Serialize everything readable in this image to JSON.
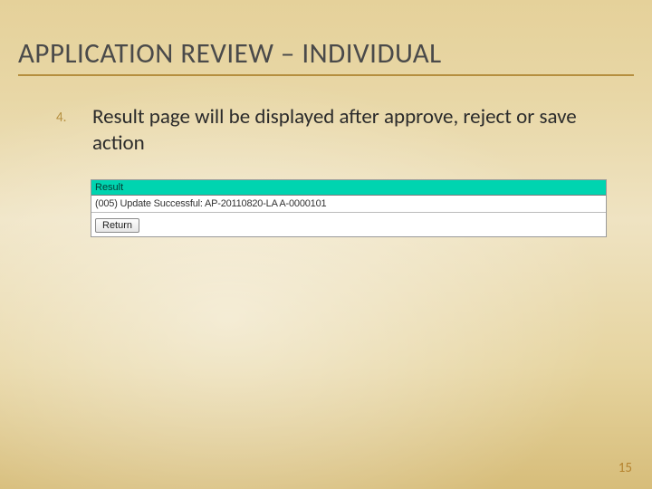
{
  "title": "APPLICATION REVIEW – INDIVIDUAL",
  "list": {
    "start_number": "4.",
    "item_text": "Result page will be displayed after approve, reject or save action"
  },
  "screenshot": {
    "header": "Result",
    "message": "(005) Update Successful: AP-20110820-LA A-0000101",
    "return_label": "Return"
  },
  "page_number": "15"
}
